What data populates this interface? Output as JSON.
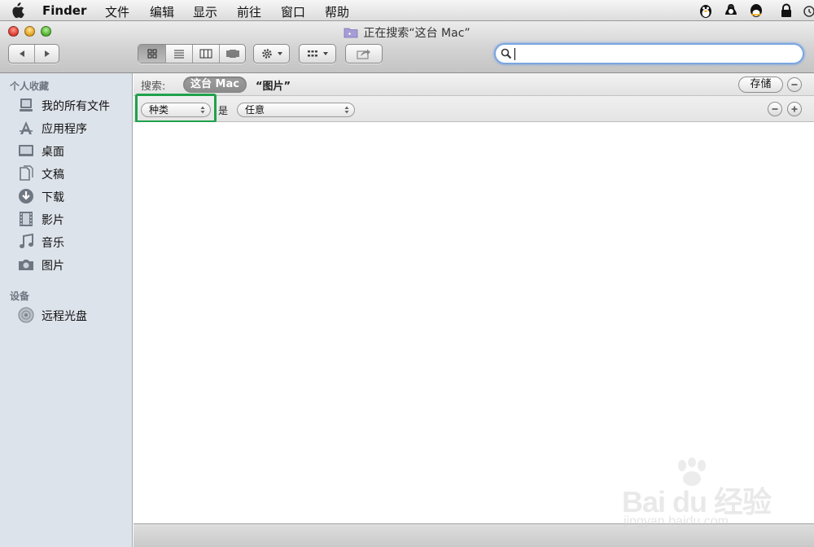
{
  "menubar": {
    "app_name": "Finder",
    "items": [
      "文件",
      "编辑",
      "显示",
      "前往",
      "窗口",
      "帮助"
    ],
    "status_icons": [
      "qq-penguin-icon",
      "tux-penguin-icon",
      "qq-icon",
      "lock-icon",
      "time-machine-icon"
    ]
  },
  "window": {
    "title": "正在搜索“这台 Mac”"
  },
  "toolbar": {
    "view_buttons": [
      "icon-view",
      "list-view",
      "column-view",
      "coverflow-view"
    ],
    "active_view": "icon-view"
  },
  "search": {
    "value": "",
    "placeholder": ""
  },
  "sidebar": {
    "favorites_heading": "个人收藏",
    "favorites": [
      {
        "label": "我的所有文件",
        "icon": "all-files-icon"
      },
      {
        "label": "应用程序",
        "icon": "applications-icon"
      },
      {
        "label": "桌面",
        "icon": "desktop-icon"
      },
      {
        "label": "文稿",
        "icon": "documents-icon"
      },
      {
        "label": "下载",
        "icon": "downloads-icon"
      },
      {
        "label": "影片",
        "icon": "movies-icon"
      },
      {
        "label": "音乐",
        "icon": "music-icon"
      },
      {
        "label": "图片",
        "icon": "pictures-icon"
      }
    ],
    "devices_heading": "设备",
    "devices": [
      {
        "label": "远程光盘",
        "icon": "remote-disc-icon"
      }
    ]
  },
  "search_bar": {
    "prefix": "搜索:",
    "scope_mac": "这台 Mac",
    "scope_folder": "“图片”",
    "save_label": "存储"
  },
  "criteria": {
    "attribute": "种类",
    "operator": "是",
    "value": "任意"
  },
  "colors": {
    "highlight": "#1fa24a",
    "search_focus": "#7aa7e0"
  },
  "watermark": {
    "text": "Bai du 经验",
    "url": "jingyan.baidu.com"
  }
}
